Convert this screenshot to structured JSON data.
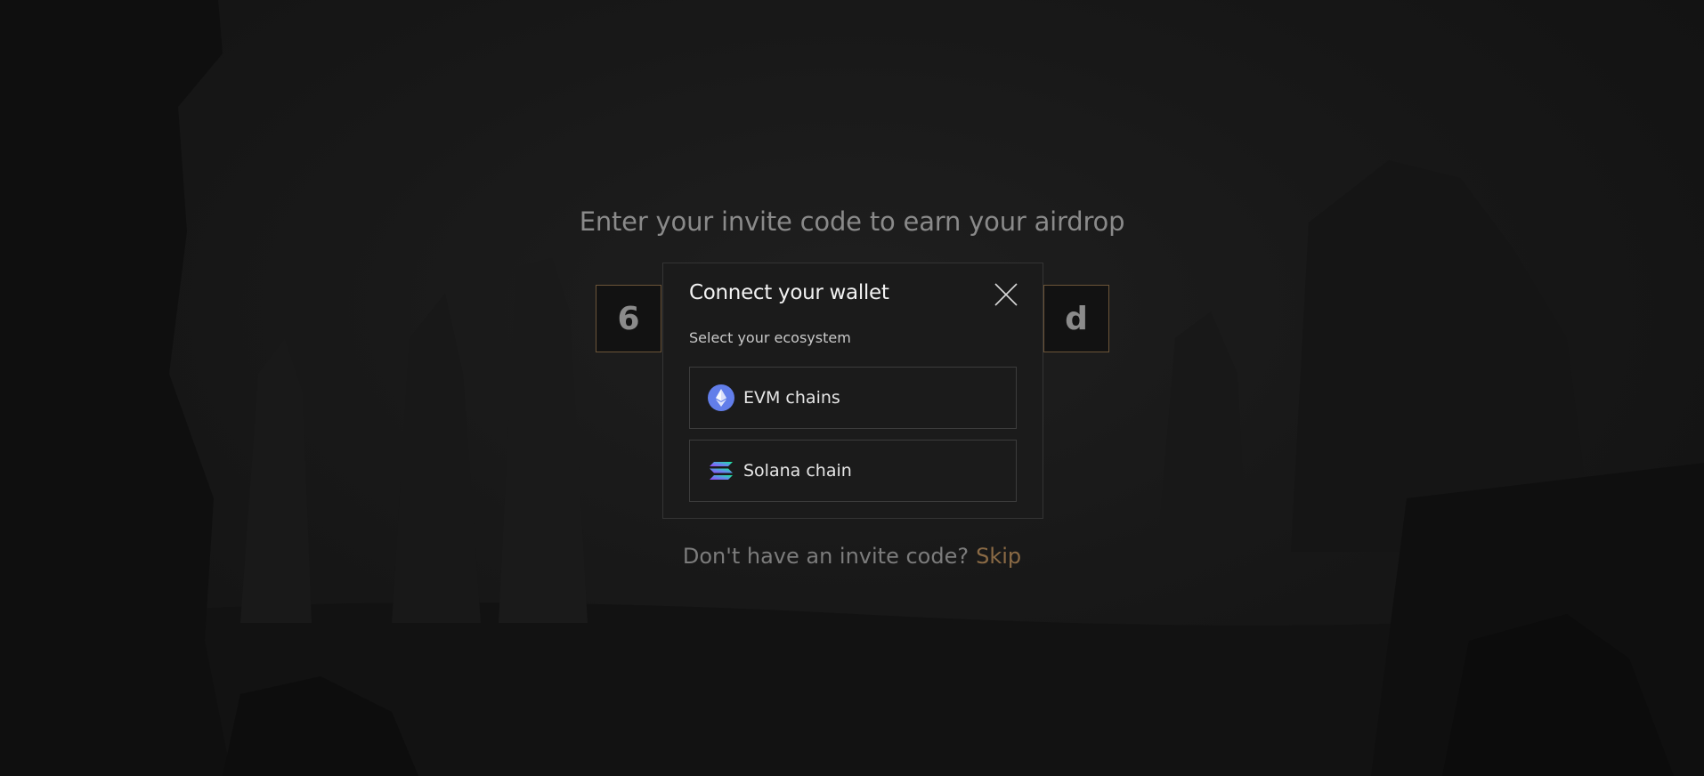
{
  "page": {
    "headline": "Enter your invite code to earn your airdrop",
    "code_first_char": "6",
    "code_last_char": "d",
    "no_code_text": "Don't have an invite code?",
    "skip_label": "Skip"
  },
  "modal": {
    "title": "Connect your wallet",
    "subtitle": "Select your ecosystem",
    "close_icon": "close-icon",
    "options": [
      {
        "label": "EVM chains",
        "icon": "ethereum-icon"
      },
      {
        "label": "Solana chain",
        "icon": "solana-icon"
      }
    ]
  },
  "colors": {
    "accent": "#8a6a45",
    "code_border": "#6b5438",
    "ethereum": "#627eea"
  }
}
